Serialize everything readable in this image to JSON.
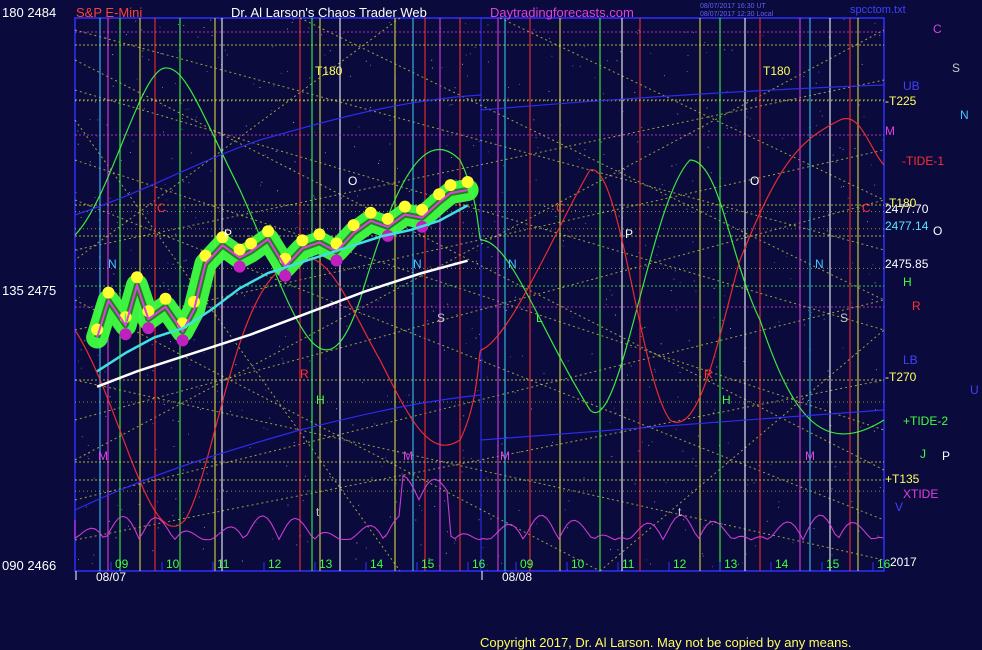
{
  "header": {
    "symbol": "S&P E-Mini",
    "title": "Dr. Al Larson's Chaos Trader Web",
    "site": "Daytradingforecasts.com",
    "stamp1": "08/07/2017 16:30 UT",
    "stamp2": "08/07/2017 12:30 Local",
    "file": "spcctom.txt"
  },
  "footer": {
    "copyright": "Copyright 2017, Dr. Al Larson. May not be copied by any means."
  },
  "left_axis": [
    {
      "angle": "180",
      "price": "2484"
    },
    {
      "angle": "135",
      "price": "2475"
    },
    {
      "angle": "090",
      "price": "2466"
    }
  ],
  "right_labels": [
    {
      "text": "C",
      "color": "#e040e0"
    },
    {
      "text": "S",
      "color": "#c8c8c8"
    },
    {
      "text": "UB",
      "color": "#4040ff"
    },
    {
      "text": "N",
      "color": "#40c8ff"
    },
    {
      "text": "-T225",
      "color": "#ffff60"
    },
    {
      "text": "M",
      "color": "#e040e0"
    },
    {
      "text": "-TIDE-1",
      "color": "#ff3030"
    },
    {
      "text": "-T180",
      "color": "#ffff60"
    },
    {
      "text": "2477.70",
      "color": "#ffffff"
    },
    {
      "text": "C",
      "color": "#ff3030"
    },
    {
      "text": "2477.14",
      "color": "#60e0ff"
    },
    {
      "text": "O",
      "color": "#ffffff"
    },
    {
      "text": "2475.85",
      "color": "#ffffff"
    },
    {
      "text": "H",
      "color": "#40ff40"
    },
    {
      "text": "R",
      "color": "#ff3030"
    },
    {
      "text": "LB",
      "color": "#4040ff"
    },
    {
      "text": "-T270",
      "color": "#ffff60"
    },
    {
      "text": "U",
      "color": "#4040ff"
    },
    {
      "text": "+TIDE-2",
      "color": "#40ff40"
    },
    {
      "text": "J",
      "color": "#40ff40"
    },
    {
      "text": "P",
      "color": "#ffffff"
    },
    {
      "text": "+T135",
      "color": "#ffff60"
    },
    {
      "text": "XTIDE",
      "color": "#e040e0"
    },
    {
      "text": "V",
      "color": "#4040ff"
    },
    {
      "text": "2017",
      "color": "#ffffff"
    }
  ],
  "x_axis": {
    "hours_day1": [
      "09",
      "10",
      "11",
      "12",
      "13",
      "14",
      "15",
      "16"
    ],
    "hours_day2": [
      "09",
      "10",
      "11",
      "12",
      "13",
      "14",
      "15",
      "16"
    ],
    "dates": [
      "08/07",
      "08/08"
    ]
  },
  "plot_labels": [
    {
      "text": "T180",
      "color": "#ffff60"
    },
    {
      "text": "T180",
      "color": "#ffff60"
    },
    {
      "text": "C",
      "color": "#ff3030"
    },
    {
      "text": "C",
      "color": "#ff3030"
    },
    {
      "text": "P",
      "color": "#ffffff"
    },
    {
      "text": "P",
      "color": "#ffffff"
    },
    {
      "text": "O",
      "color": "#ffffff"
    },
    {
      "text": "O",
      "color": "#ffffff"
    },
    {
      "text": "N",
      "color": "#40c8ff"
    },
    {
      "text": "N",
      "color": "#40c8ff"
    },
    {
      "text": "N",
      "color": "#40c8ff"
    },
    {
      "text": "N",
      "color": "#40c8ff"
    },
    {
      "text": "S",
      "color": "#c8c8c8"
    },
    {
      "text": "S",
      "color": "#c8c8c8"
    },
    {
      "text": "H",
      "color": "#40ff40"
    },
    {
      "text": "H",
      "color": "#40ff40"
    },
    {
      "text": "R",
      "color": "#ff3030"
    },
    {
      "text": "R",
      "color": "#ff3030"
    },
    {
      "text": "M",
      "color": "#e040e0"
    },
    {
      "text": "M",
      "color": "#e040e0"
    },
    {
      "text": "M",
      "color": "#e040e0"
    },
    {
      "text": "M",
      "color": "#e040e0"
    },
    {
      "text": "t",
      "color": "#c8c8c8"
    },
    {
      "text": "t",
      "color": "#c8c8c8"
    },
    {
      "text": "L",
      "color": "#40ff40"
    },
    {
      "text": "L",
      "color": "#40ff40"
    }
  ],
  "chart_data": {
    "type": "line",
    "ylim": [
      2466,
      2484
    ],
    "price_points": [
      [
        9.3,
        2473.6
      ],
      [
        9.5,
        2474.8
      ],
      [
        9.8,
        2474.0
      ],
      [
        10.0,
        2475.3
      ],
      [
        10.2,
        2474.2
      ],
      [
        10.5,
        2474.6
      ],
      [
        10.8,
        2473.8
      ],
      [
        11.0,
        2474.5
      ],
      [
        11.2,
        2476.0
      ],
      [
        11.5,
        2476.6
      ],
      [
        11.8,
        2476.2
      ],
      [
        12.0,
        2476.4
      ],
      [
        12.3,
        2476.8
      ],
      [
        12.6,
        2475.9
      ],
      [
        12.9,
        2476.5
      ],
      [
        13.2,
        2476.7
      ],
      [
        13.5,
        2476.4
      ],
      [
        13.8,
        2477.0
      ],
      [
        14.1,
        2477.4
      ],
      [
        14.4,
        2477.2
      ],
      [
        14.7,
        2477.6
      ],
      [
        15.0,
        2477.5
      ],
      [
        15.3,
        2478.0
      ],
      [
        15.5,
        2478.3
      ],
      [
        15.8,
        2478.4
      ]
    ],
    "ma_fast": [
      [
        9.3,
        2472.5
      ],
      [
        9.8,
        2473.1
      ],
      [
        10.3,
        2473.6
      ],
      [
        10.8,
        2473.9
      ],
      [
        11.3,
        2474.5
      ],
      [
        11.8,
        2475.2
      ],
      [
        12.3,
        2475.7
      ],
      [
        12.8,
        2476.0
      ],
      [
        13.3,
        2476.3
      ],
      [
        13.8,
        2476.6
      ],
      [
        14.3,
        2476.9
      ],
      [
        14.8,
        2477.1
      ],
      [
        15.3,
        2477.4
      ],
      [
        15.8,
        2477.9
      ]
    ],
    "ma_slow": [
      [
        9.3,
        2472.0
      ],
      [
        10.0,
        2472.5
      ],
      [
        11.0,
        2473.1
      ],
      [
        12.0,
        2473.7
      ],
      [
        13.0,
        2474.4
      ],
      [
        14.0,
        2475.1
      ],
      [
        15.0,
        2475.7
      ],
      [
        15.8,
        2476.1
      ]
    ],
    "reference_levels": [
      {
        "label": "-T225",
        "y": 2481.3
      },
      {
        "label": "-T180",
        "y": 2477.7
      },
      {
        "label": "2477.14",
        "y": 2477.14
      },
      {
        "label": "2475.85",
        "y": 2475.85
      },
      {
        "label": "-T270",
        "y": 2471.5
      },
      {
        "label": "+T135",
        "y": 2468.6
      }
    ]
  }
}
